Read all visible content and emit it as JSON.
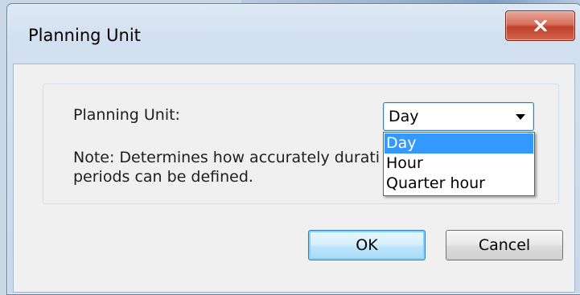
{
  "window": {
    "title": "Planning Unit",
    "close_icon": "close-icon"
  },
  "form": {
    "planning_unit_label": "Planning Unit:",
    "select": {
      "value": "Day",
      "options": [
        "Day",
        "Hour",
        "Quarter hour"
      ],
      "highlighted": "Day"
    },
    "note": "Note: Determines how accurately durati",
    "note_line2": "periods can be defined."
  },
  "buttons": {
    "ok": "OK",
    "cancel": "Cancel"
  },
  "colors": {
    "selection": "#3399ff",
    "close_button": "#c0402a"
  }
}
